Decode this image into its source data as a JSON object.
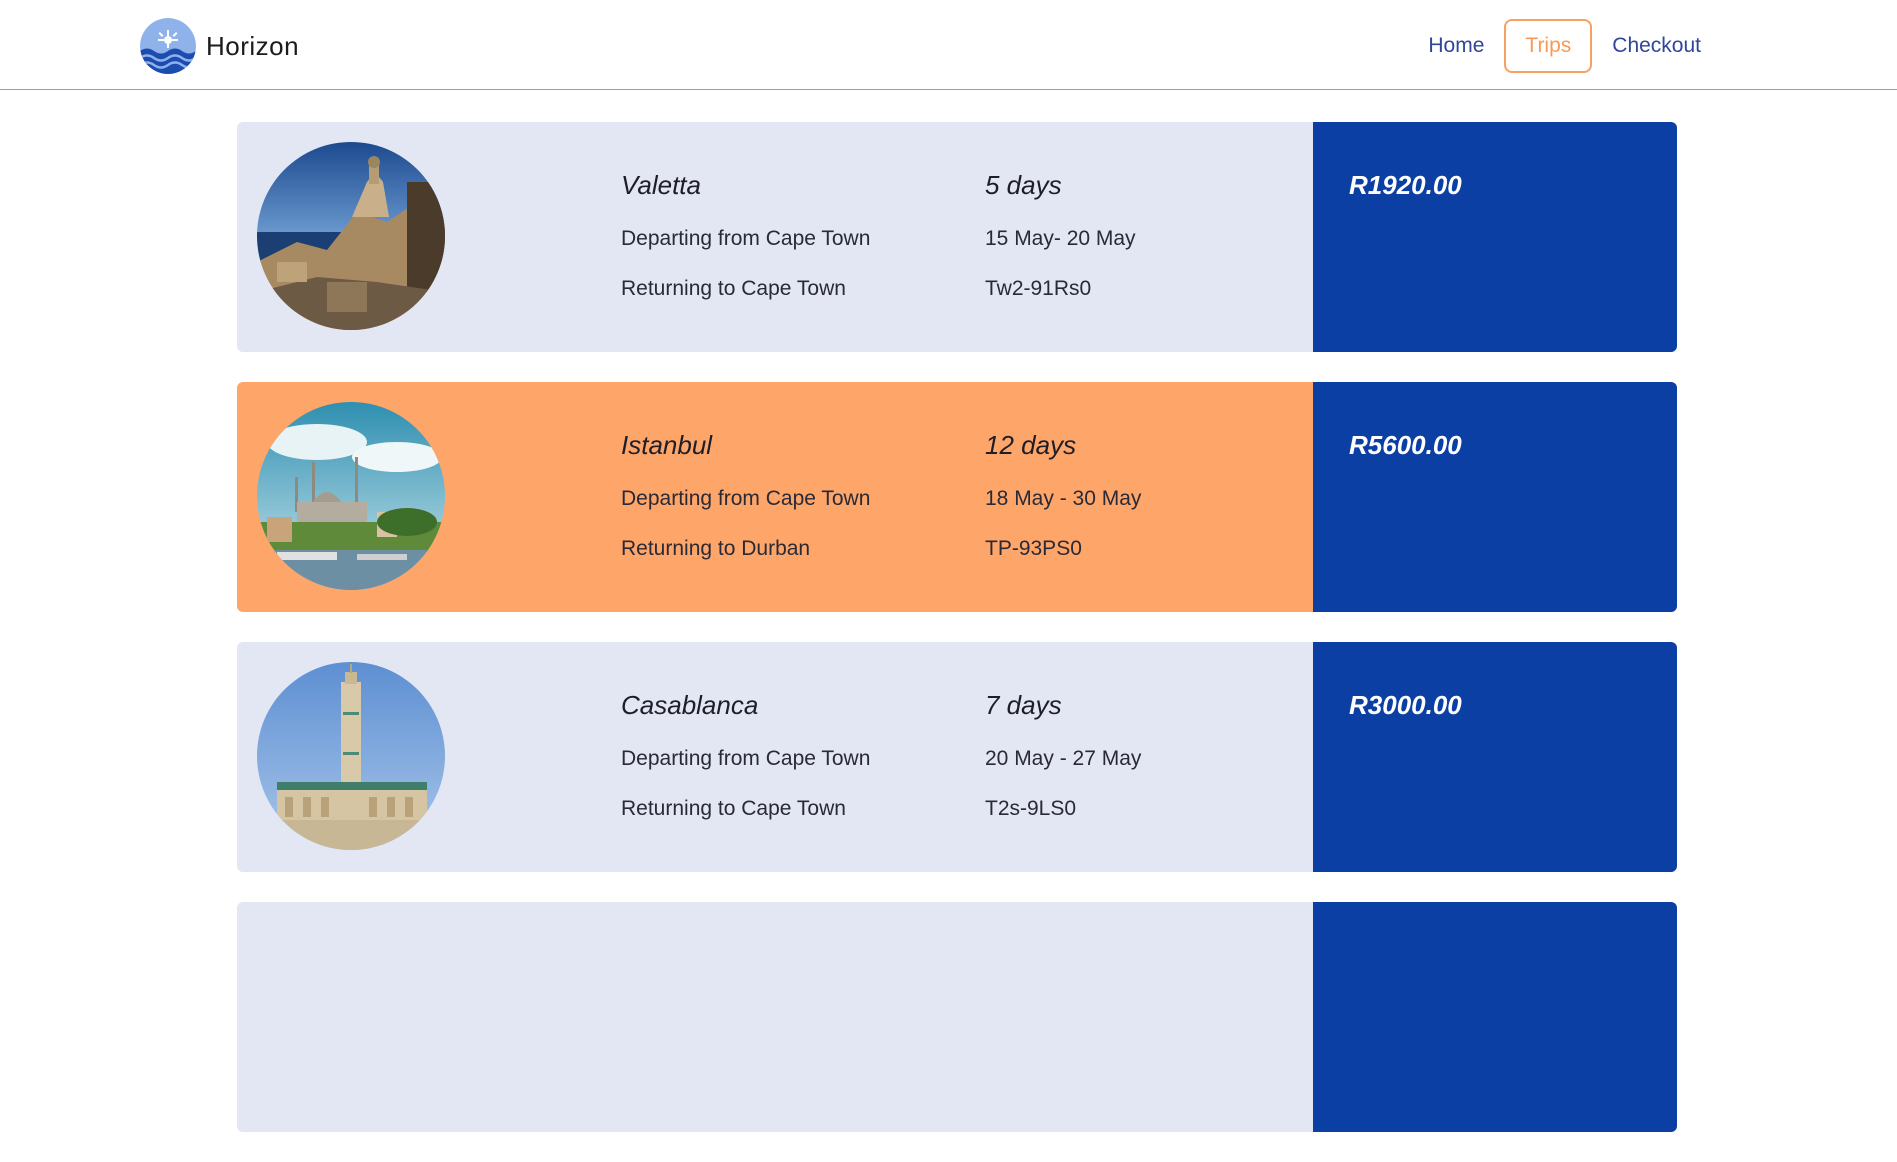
{
  "brand": {
    "name": "Horizon",
    "logo_icon": "sun-waves-logo-icon"
  },
  "nav": {
    "items": [
      {
        "label": "Home"
      },
      {
        "label": "Trips"
      },
      {
        "label": "Checkout"
      }
    ],
    "active": "Trips"
  },
  "trips": [
    {
      "city": "Valetta",
      "duration": "5 days",
      "departing": "Departing from Cape Town",
      "dates": "15 May- 20 May",
      "returning": "Returning to Cape Town",
      "code": "Tw2-91Rs0",
      "price": "R1920.00",
      "highlighted": false
    },
    {
      "city": "Istanbul",
      "duration": "12 days",
      "departing": "Departing from Cape Town",
      "dates": "18 May - 30 May",
      "returning": "Returning to Durban",
      "code": "TP-93PS0",
      "price": "R5600.00",
      "highlighted": true
    },
    {
      "city": "Casablanca",
      "duration": "7 days",
      "departing": "Departing from Cape Town",
      "dates": "20 May - 27 May",
      "returning": "Returning to Cape Town",
      "code": "T2s-9LS0",
      "price": "R3000.00",
      "highlighted": false
    },
    {
      "city": "",
      "duration": "",
      "departing": "",
      "dates": "",
      "returning": "",
      "code": "",
      "price": "",
      "highlighted": false
    }
  ],
  "colors": {
    "nav_link": "#2f4699",
    "nav_active": "#f79a55",
    "card_bg": "#e3e6f3",
    "card_highlight": "#fea569",
    "price_panel": "#0b3fa3"
  }
}
